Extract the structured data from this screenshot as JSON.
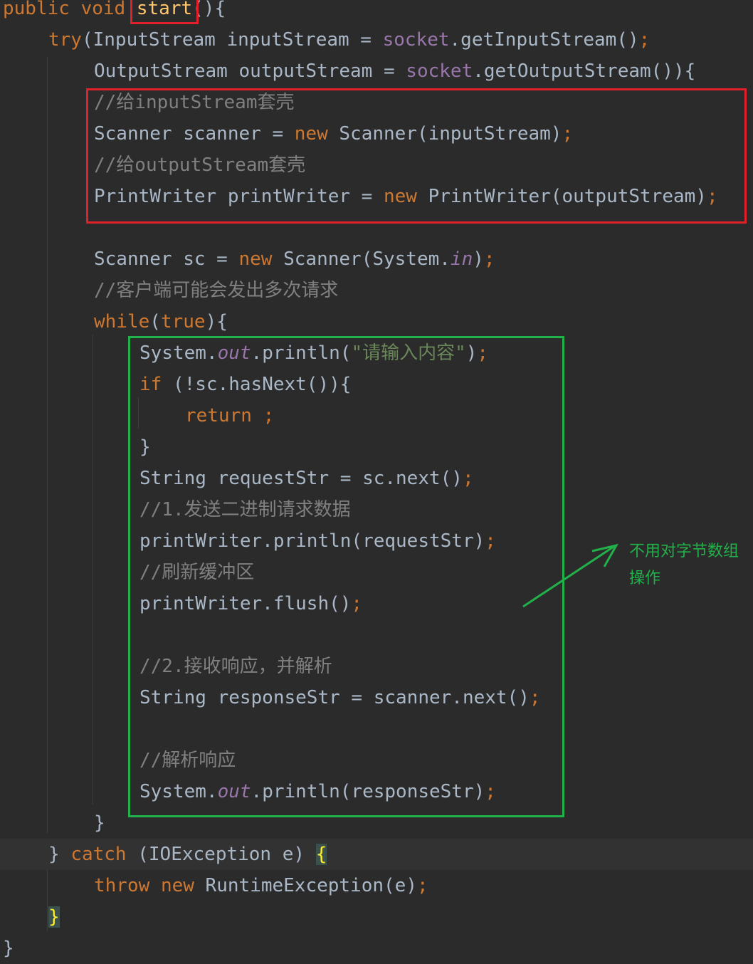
{
  "editor": {
    "lines": [
      {
        "id": "L1",
        "indent": 0,
        "tokens": [
          {
            "t": "public",
            "c": "kw"
          },
          {
            "t": " ",
            "c": ""
          },
          {
            "t": "void",
            "c": "kw"
          },
          {
            "t": " ",
            "c": ""
          },
          {
            "t": "start",
            "c": "fn"
          },
          {
            "t": "(){",
            "c": ""
          }
        ]
      },
      {
        "id": "L2",
        "indent": 1,
        "tokens": [
          {
            "t": "try",
            "c": "kw"
          },
          {
            "t": "(InputStream inputStream = ",
            "c": ""
          },
          {
            "t": "socket",
            "c": "fld"
          },
          {
            "t": ".getInputStream()",
            "c": ""
          },
          {
            "t": ";",
            "c": "kw"
          }
        ]
      },
      {
        "id": "L3",
        "indent": 2,
        "tokens": [
          {
            "t": "OutputStream outputStream = ",
            "c": ""
          },
          {
            "t": "socket",
            "c": "fld"
          },
          {
            "t": ".getOutputStream()){",
            "c": ""
          }
        ]
      },
      {
        "id": "L4",
        "indent": 2,
        "tokens": [
          {
            "t": "//给inputStream套壳",
            "c": "cmt"
          }
        ]
      },
      {
        "id": "L5",
        "indent": 2,
        "tokens": [
          {
            "t": "Scanner scanner = ",
            "c": ""
          },
          {
            "t": "new",
            "c": "kw"
          },
          {
            "t": " Scanner(inputStream)",
            "c": ""
          },
          {
            "t": ";",
            "c": "kw"
          }
        ]
      },
      {
        "id": "L6",
        "indent": 2,
        "tokens": [
          {
            "t": "//给outputStream套壳",
            "c": "cmt"
          }
        ]
      },
      {
        "id": "L7",
        "indent": 2,
        "tokens": [
          {
            "t": "PrintWriter printWriter = ",
            "c": ""
          },
          {
            "t": "new",
            "c": "kw"
          },
          {
            "t": " PrintWriter(outputStream)",
            "c": ""
          },
          {
            "t": ";",
            "c": "kw"
          }
        ]
      },
      {
        "id": "L8",
        "indent": 2,
        "tokens": []
      },
      {
        "id": "L9",
        "indent": 2,
        "tokens": [
          {
            "t": "Scanner sc = ",
            "c": ""
          },
          {
            "t": "new",
            "c": "kw"
          },
          {
            "t": " Scanner(System.",
            "c": ""
          },
          {
            "t": "in",
            "c": "ita"
          },
          {
            "t": ")",
            "c": ""
          },
          {
            "t": ";",
            "c": "kw"
          }
        ]
      },
      {
        "id": "L10",
        "indent": 2,
        "tokens": [
          {
            "t": "//客户端可能会发出多次请求",
            "c": "cmt"
          }
        ]
      },
      {
        "id": "L11",
        "indent": 2,
        "tokens": [
          {
            "t": "while",
            "c": "kw"
          },
          {
            "t": "(",
            "c": ""
          },
          {
            "t": "true",
            "c": "kw"
          },
          {
            "t": "){",
            "c": ""
          }
        ]
      },
      {
        "id": "L12",
        "indent": 3,
        "tokens": [
          {
            "t": "System.",
            "c": ""
          },
          {
            "t": "out",
            "c": "ita"
          },
          {
            "t": ".println(",
            "c": ""
          },
          {
            "t": "\"请输入内容\"",
            "c": "str"
          },
          {
            "t": ")",
            "c": ""
          },
          {
            "t": ";",
            "c": "kw"
          }
        ]
      },
      {
        "id": "L13",
        "indent": 3,
        "tokens": [
          {
            "t": "if",
            "c": "kw"
          },
          {
            "t": " (!sc.hasNext()){",
            "c": ""
          }
        ]
      },
      {
        "id": "L14",
        "indent": 4,
        "tokens": [
          {
            "t": "return ;",
            "c": "kw"
          }
        ]
      },
      {
        "id": "L15",
        "indent": 3,
        "tokens": [
          {
            "t": "}",
            "c": ""
          }
        ]
      },
      {
        "id": "L16",
        "indent": 3,
        "tokens": [
          {
            "t": "String requestStr = sc.next()",
            "c": ""
          },
          {
            "t": ";",
            "c": "kw"
          }
        ]
      },
      {
        "id": "L17",
        "indent": 3,
        "tokens": [
          {
            "t": "//1.发送二进制请求数据",
            "c": "cmt"
          }
        ]
      },
      {
        "id": "L18",
        "indent": 3,
        "tokens": [
          {
            "t": "printWriter.println(requestStr)",
            "c": ""
          },
          {
            "t": ";",
            "c": "kw"
          }
        ]
      },
      {
        "id": "L19",
        "indent": 3,
        "tokens": [
          {
            "t": "//刷新缓冲区",
            "c": "cmt"
          }
        ]
      },
      {
        "id": "L20",
        "indent": 3,
        "tokens": [
          {
            "t": "printWriter.flush()",
            "c": ""
          },
          {
            "t": ";",
            "c": "kw"
          }
        ]
      },
      {
        "id": "L21",
        "indent": 3,
        "tokens": []
      },
      {
        "id": "L22",
        "indent": 3,
        "tokens": [
          {
            "t": "//2.接收响应，并解析",
            "c": "cmt"
          }
        ]
      },
      {
        "id": "L23",
        "indent": 3,
        "tokens": [
          {
            "t": "String responseStr = scanner.next()",
            "c": ""
          },
          {
            "t": ";",
            "c": "kw"
          }
        ]
      },
      {
        "id": "L24",
        "indent": 3,
        "tokens": []
      },
      {
        "id": "L25",
        "indent": 3,
        "tokens": [
          {
            "t": "//解析响应",
            "c": "cmt"
          }
        ]
      },
      {
        "id": "L26",
        "indent": 3,
        "tokens": [
          {
            "t": "System.",
            "c": ""
          },
          {
            "t": "out",
            "c": "ita"
          },
          {
            "t": ".println(responseStr)",
            "c": ""
          },
          {
            "t": ";",
            "c": "kw"
          }
        ]
      },
      {
        "id": "L27",
        "indent": 2,
        "tokens": [
          {
            "t": "}",
            "c": ""
          }
        ]
      },
      {
        "id": "L28",
        "indent": 1,
        "highlight": true,
        "tokens": [
          {
            "t": "} ",
            "c": ""
          },
          {
            "t": "catch",
            "c": "kw"
          },
          {
            "t": " (IOException e) ",
            "c": ""
          },
          {
            "t": "{",
            "c": "brace-y"
          }
        ]
      },
      {
        "id": "L29",
        "indent": 2,
        "tokens": [
          {
            "t": "throw",
            "c": "kw"
          },
          {
            "t": " ",
            "c": ""
          },
          {
            "t": "new",
            "c": "kw"
          },
          {
            "t": " RuntimeException(e)",
            "c": ""
          },
          {
            "t": ";",
            "c": "kw"
          }
        ]
      },
      {
        "id": "L30",
        "indent": 1,
        "tokens": [
          {
            "t": "}",
            "c": "brace-y"
          }
        ]
      },
      {
        "id": "L31",
        "indent": 0,
        "tokens": [
          {
            "t": "}",
            "c": ""
          }
        ]
      }
    ]
  },
  "annotation": {
    "text": "不用对字节数组操作",
    "color": "#22b04a"
  },
  "colors": {
    "background": "#2b2b2b",
    "keyword": "#cc7832",
    "field": "#9876aa",
    "comment": "#808080",
    "string": "#6a8759",
    "red_box": "#e0202a",
    "green_box": "#22b04a"
  }
}
